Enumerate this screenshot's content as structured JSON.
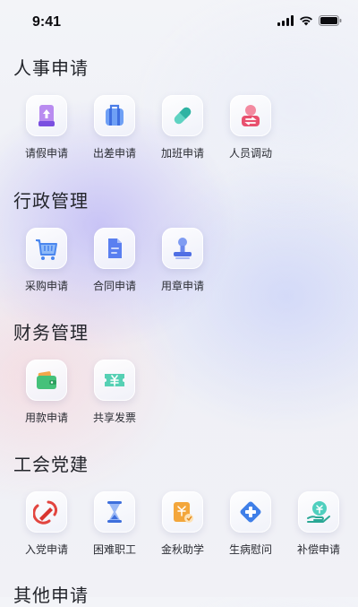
{
  "status_bar": {
    "time": "9:41"
  },
  "sections": [
    {
      "title": "人事申请",
      "items": [
        {
          "label": "请假申请",
          "icon": "leave-upload-icon"
        },
        {
          "label": "出差申请",
          "icon": "suitcase-icon"
        },
        {
          "label": "加班申请",
          "icon": "capsule-icon"
        },
        {
          "label": "人员调动",
          "icon": "transfer-icon"
        }
      ]
    },
    {
      "title": "行政管理",
      "items": [
        {
          "label": "采购申请",
          "icon": "shopping-cart-icon"
        },
        {
          "label": "合同申请",
          "icon": "document-icon"
        },
        {
          "label": "用章申请",
          "icon": "seal-stamp-icon"
        }
      ]
    },
    {
      "title": "财务管理",
      "items": [
        {
          "label": "用款申请",
          "icon": "wallet-icon"
        },
        {
          "label": "共享发票",
          "icon": "invoice-icon"
        }
      ]
    },
    {
      "title": "工会党建",
      "items": [
        {
          "label": "入党申请",
          "icon": "party-emblem-icon"
        },
        {
          "label": "困难职工",
          "icon": "hourglass-icon"
        },
        {
          "label": "金秋助学",
          "icon": "education-aid-icon"
        },
        {
          "label": "生病慰问",
          "icon": "medical-cross-icon"
        },
        {
          "label": "补偿申请",
          "icon": "compensation-icon"
        }
      ]
    },
    {
      "title": "其他申请",
      "items": []
    }
  ]
}
